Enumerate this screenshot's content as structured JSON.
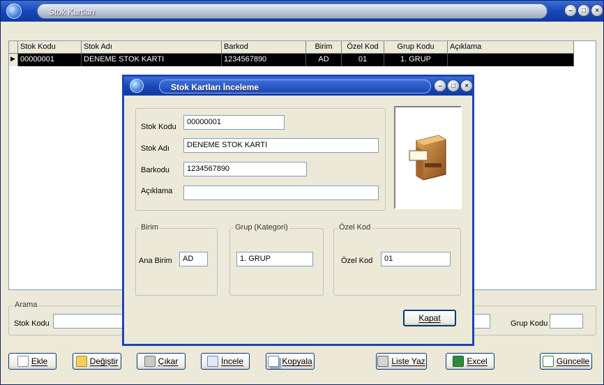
{
  "window": {
    "title": "Stok Kartları"
  },
  "grid": {
    "columns": [
      "Stok Kodu",
      "Stok Adı",
      "Barkod",
      "Birim",
      "Özel Kod",
      "Grup Kodu",
      "Açıklama"
    ],
    "rows": [
      {
        "stok_kodu": "00000001",
        "stok_adi": "DENEME STOK KARTI",
        "barkod": "1234567890",
        "birim": "AD",
        "ozel_kod": "01",
        "grup_kodu": "1. GRUP",
        "aciklama": ""
      }
    ]
  },
  "search": {
    "group_label": "Arama",
    "stok_kodu_label": "Stok Kodu",
    "stok_kodu_value": "",
    "grup_kodu_label": "Grup Kodu",
    "grup_kodu_value": ""
  },
  "buttons": {
    "ekle": "Ekle",
    "degistir": "Değiştir",
    "cikar": "Çıkar",
    "incele": "İncele",
    "kopyala": "Kopyala",
    "liste_yaz": "Liste Yaz",
    "excel": "Excel",
    "guncelle": "Güncelle"
  },
  "dialog": {
    "title": "Stok Kartları İnceleme",
    "fields": {
      "stok_kodu_label": "Stok Kodu",
      "stok_kodu_value": "00000001",
      "stok_adi_label": "Stok Adı",
      "stok_adi_value": "DENEME STOK KARTI",
      "barkodu_label": "Barkodu",
      "barkodu_value": "1234567890",
      "aciklama_label": "Açıklama",
      "aciklama_value": ""
    },
    "birim": {
      "group_label": "Birim",
      "ana_birim_label": "Ana Birim",
      "ana_birim_value": "AD"
    },
    "grup": {
      "group_label": "Grup (Kategori)",
      "value": "1. GRUP"
    },
    "ozel_kod": {
      "group_label": "Özel Kod",
      "label": "Özel Kod",
      "value": "01"
    },
    "kapat_label": "Kapat"
  },
  "icons": [
    "app-globe-icon",
    "minimize-icon",
    "maximize-icon",
    "close-icon",
    "cabinet-icon"
  ]
}
